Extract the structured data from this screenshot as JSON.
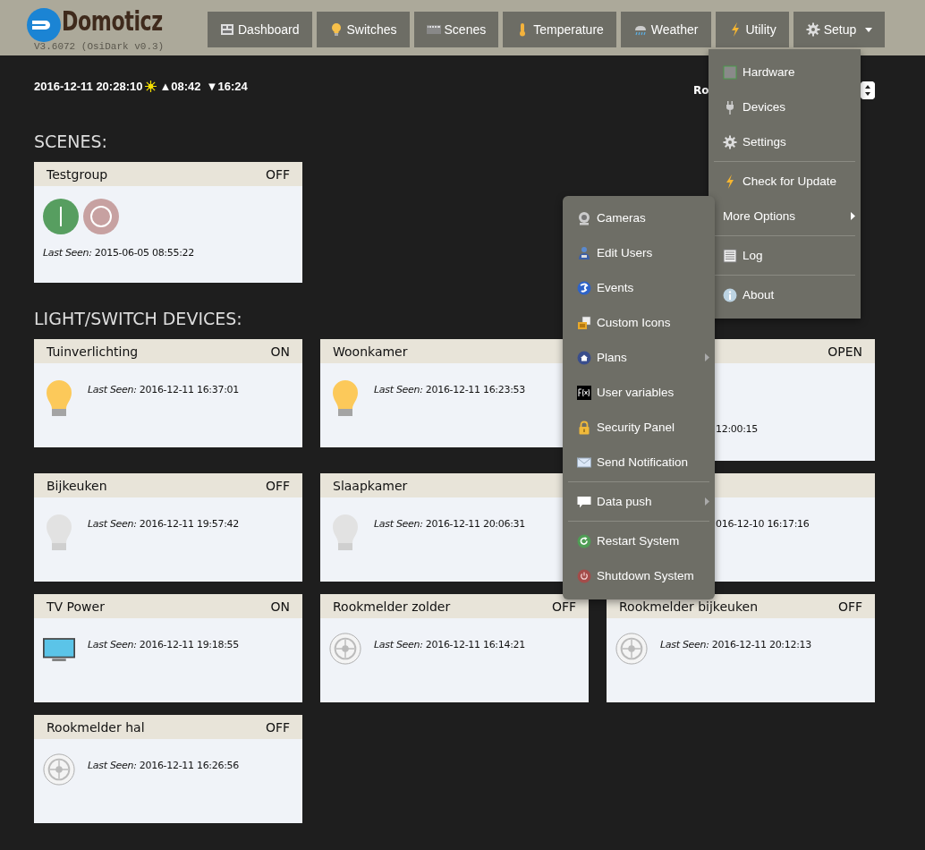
{
  "header": {
    "logo": {
      "title": "Domoticz",
      "version": "V3.6072 (OsiDark v0.3)"
    },
    "nav": [
      {
        "label": "Dashboard",
        "kind": "dashboard",
        "dropdown": false
      },
      {
        "label": "Switches",
        "kind": "bulb",
        "dropdown": false
      },
      {
        "label": "Scenes",
        "kind": "film",
        "dropdown": false
      },
      {
        "label": "Temperature",
        "kind": "thermometer",
        "dropdown": false
      },
      {
        "label": "Weather",
        "kind": "rain",
        "dropdown": false
      },
      {
        "label": "Utility",
        "kind": "bolt",
        "dropdown": false
      },
      {
        "label": "Setup",
        "kind": "gear",
        "dropdown": true
      }
    ]
  },
  "info": {
    "datetime": "2016-12-11 20:28:10",
    "sunrise": "▲08:42",
    "sunset": "▼16:24",
    "room_label": "Ro"
  },
  "scenes": {
    "title": "SCENES:",
    "cards": [
      {
        "name": "Testgroup",
        "status": "OFF",
        "last_seen": "*Last Seen:* 2015-06-05 08:55:22"
      }
    ]
  },
  "devices": {
    "title": "LIGHT/SWITCH DEVICES:",
    "cards": [
      {
        "kind": "bulb_on",
        "name": "Tuinverlichting",
        "status": "ON",
        "last_seen": "*Last Seen:* 2016-12-11 16:37:01"
      },
      {
        "kind": "bulb_on",
        "name": "Woonkamer",
        "last_seen": "*Last Seen:* 2016-12-11 16:23:53"
      },
      {
        "kind": "covered_tall",
        "status": "OPEN",
        "last_seen": "12:00:15"
      },
      {
        "kind": "bulb_off",
        "name": "Bijkeuken",
        "status": "OFF",
        "last_seen": "*Last Seen:* 2016-12-11 19:57:42"
      },
      {
        "kind": "bulb_off",
        "name": "Slaapkamer",
        "last_seen": "*Last Seen:* 2016-12-11 20:06:31"
      },
      {
        "kind": "covered",
        "last_seen": "016-12-10 16:17:16"
      },
      {
        "kind": "tv",
        "name": "TV Power",
        "status": "ON",
        "last_seen": "*Last Seen:* 2016-12-11 19:18:55"
      },
      {
        "kind": "smoke",
        "name": "Rookmelder zolder",
        "status": "OFF",
        "last_seen": "*Last Seen:* 2016-12-11 16:14:21"
      },
      {
        "kind": "smoke",
        "name": "Rookmelder bijkeuken",
        "status": "OFF",
        "last_seen": "*Last Seen:* 2016-12-11 20:12:13"
      },
      {
        "kind": "smoke",
        "name": "Rookmelder hal",
        "status": "OFF",
        "last_seen": "*Last Seen:* 2016-12-11 16:26:56"
      }
    ]
  },
  "setup_menu": {
    "items": [
      {
        "label": "Hardware",
        "kind": "chip",
        "submenu": false,
        "divider_before": false
      },
      {
        "label": "Devices",
        "kind": "plug",
        "submenu": false,
        "divider_before": false
      },
      {
        "label": "Settings",
        "kind": "gear",
        "submenu": false,
        "divider_before": false
      },
      {
        "label": "Check for Update",
        "kind": "bolt",
        "submenu": false,
        "divider_before": true
      },
      {
        "label": "More Options",
        "kind": "plain",
        "submenu": true,
        "divider_before": false
      },
      {
        "label": "Log",
        "kind": "log",
        "submenu": false,
        "divider_before": true
      },
      {
        "label": "About",
        "kind": "info",
        "submenu": false,
        "divider_before": true
      }
    ]
  },
  "more_options_menu": {
    "items": [
      {
        "label": "Cameras",
        "kind": "camera",
        "submenu": false,
        "divider_before": false
      },
      {
        "label": "Edit Users",
        "kind": "users",
        "submenu": false,
        "divider_before": false
      },
      {
        "label": "Events",
        "kind": "events",
        "submenu": false,
        "divider_before": false
      },
      {
        "label": "Custom Icons",
        "kind": "images",
        "submenu": false,
        "divider_before": false
      },
      {
        "label": "Plans",
        "kind": "plans",
        "submenu": true,
        "divider_before": false
      },
      {
        "label": "User variables",
        "kind": "fx",
        "submenu": false,
        "divider_before": false
      },
      {
        "label": "Security Panel",
        "kind": "lock",
        "submenu": false,
        "divider_before": false
      },
      {
        "label": "Send Notification",
        "kind": "mail",
        "submenu": false,
        "divider_before": false
      },
      {
        "label": "Data push",
        "kind": "chat",
        "submenu": true,
        "divider_before": true
      },
      {
        "label": "Restart System",
        "kind": "restart",
        "submenu": false,
        "divider_before": true
      },
      {
        "label": "Shutdown System",
        "kind": "power",
        "submenu": false,
        "divider_before": false
      }
    ]
  }
}
